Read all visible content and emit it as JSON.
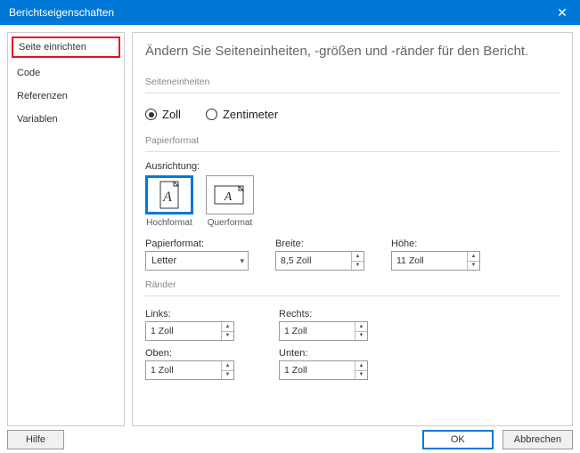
{
  "title": "Berichtseigenschaften",
  "sidebar": {
    "items": [
      {
        "label": "Seite einrichten",
        "selected": true
      },
      {
        "label": "Code"
      },
      {
        "label": "Referenzen"
      },
      {
        "label": "Variablen"
      }
    ]
  },
  "heading": "Ändern Sie Seiteneinheiten, -größen und -ränder für den Bericht.",
  "units": {
    "group": "Seiteneinheiten",
    "inch": "Zoll",
    "cm": "Zentimeter"
  },
  "paper": {
    "group": "Papierformat",
    "orientationLabel": "Ausrichtung:",
    "portrait": "Hochformat",
    "landscape": "Querformat",
    "sizeLabel": "Papierformat:",
    "sizeValue": "Letter",
    "widthLabel": "Breite:",
    "widthValue": "8,5 Zoll",
    "heightLabel": "Höhe:",
    "heightValue": "11 Zoll"
  },
  "margins": {
    "group": "Ränder",
    "leftLabel": "Links:",
    "leftValue": "1 Zoll",
    "rightLabel": "Rechts:",
    "rightValue": "1 Zoll",
    "topLabel": "Oben:",
    "topValue": "1 Zoll",
    "bottomLabel": "Unten:",
    "bottomValue": "1 Zoll"
  },
  "footer": {
    "help": "Hilfe",
    "ok": "OK",
    "cancel": "Abbrechen"
  }
}
